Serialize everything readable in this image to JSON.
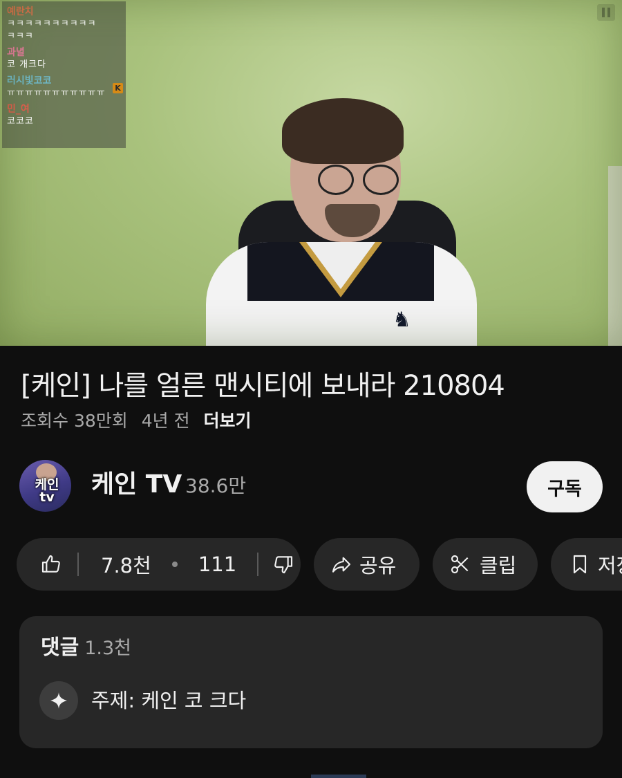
{
  "video": {
    "chat": [
      {
        "user": "예란치",
        "user_color": "#e0704c",
        "message": "ㅋㅋㅋㅋㅋㅋㅋㅋㅋㅋ"
      },
      {
        "user": "",
        "user_color": "#ffffff",
        "message": "ㅋㅋㅋ"
      },
      {
        "user": "과녈",
        "user_color": "#e47a9a",
        "message": "코 개크다"
      },
      {
        "user": "러시빛코코",
        "user_color": "#6fb9c9",
        "message": "ㅠㅠㅠㅠㅠㅠㅠㅠㅠㅠㅠ"
      },
      {
        "user": "민_여",
        "user_color": "#e35d4d",
        "message": "코코코"
      }
    ],
    "chat_badge": "K",
    "control_icon": "pause-icon"
  },
  "info": {
    "title": "[케인] 나를 얼른 맨시티에 보내라 210804",
    "views": "조회수 38만회",
    "age": "4년 전",
    "more": "더보기"
  },
  "channel": {
    "name": "케인 TV",
    "subscribers": "38.6만",
    "avatar_text": "케인 tv",
    "subscribe_label": "구독"
  },
  "actions": {
    "likes": "7.8천",
    "dislikes": "111",
    "share": "공유",
    "clip": "클립",
    "save": "저장"
  },
  "comments": {
    "label": "댓글",
    "count": "1.3천",
    "topic": "주제: 케인 코 크다"
  },
  "colors": {
    "background": "#0f0f0f",
    "pill": "#272727",
    "text": "#f1f1f1",
    "secondary_text": "#aaaaaa"
  }
}
